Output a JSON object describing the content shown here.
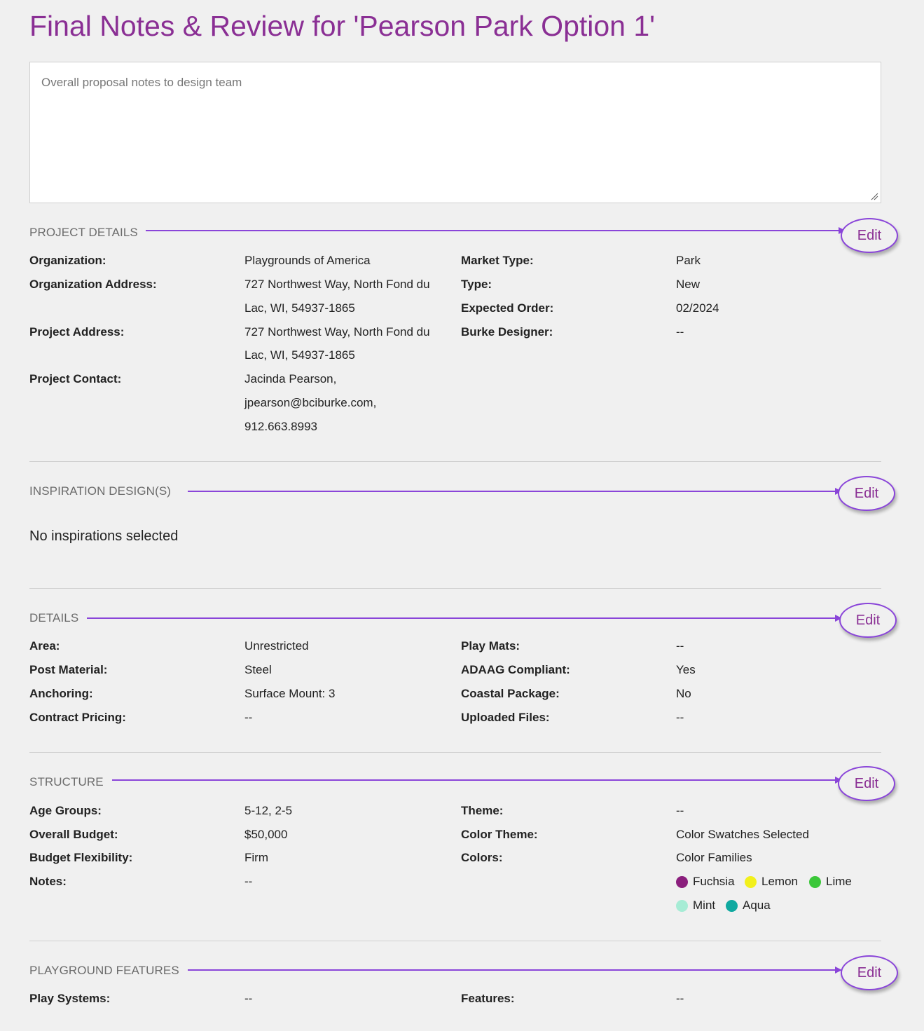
{
  "page": {
    "title": "Final Notes & Review for 'Pearson Park Option 1'",
    "notes_placeholder": "Overall proposal notes to design team",
    "notes_value": ""
  },
  "edit_label": "Edit",
  "project_details": {
    "title": "PROJECT DETAILS",
    "organization": {
      "label": "Organization:",
      "value": "Playgrounds of America"
    },
    "organization_address": {
      "label": "Organization Address:",
      "line1": "727 Northwest Way, North Fond du",
      "line2": "Lac, WI, 54937-1865"
    },
    "project_address": {
      "label": "Project Address:",
      "line1": "727 Northwest Way, North Fond du",
      "line2": "Lac, WI, 54937-1865"
    },
    "project_contact": {
      "label": "Project Contact:",
      "line1": "Jacinda Pearson,",
      "line2": "jpearson@bciburke.com,",
      "line3": "912.663.8993"
    },
    "market_type": {
      "label": "Market Type:",
      "value": "Park"
    },
    "type": {
      "label": "Type:",
      "value": "New"
    },
    "expected_order": {
      "label": "Expected Order:",
      "value": "02/2024"
    },
    "burke_designer": {
      "label": "Burke Designer:",
      "value": "--"
    }
  },
  "inspiration": {
    "title": "INSPIRATION DESIGN(S)",
    "empty_text": "No inspirations selected"
  },
  "details": {
    "title": "DETAILS",
    "area": {
      "label": "Area:",
      "value": "Unrestricted"
    },
    "post_material": {
      "label": "Post Material:",
      "value": "Steel"
    },
    "anchoring": {
      "label": "Anchoring:",
      "value": "Surface Mount: 3"
    },
    "contract_pricing": {
      "label": "Contract Pricing:",
      "value": "--"
    },
    "play_mats": {
      "label": "Play Mats:",
      "value": "--"
    },
    "adaag": {
      "label": "ADAAG Compliant:",
      "value": "Yes"
    },
    "coastal": {
      "label": "Coastal Package:",
      "value": "No"
    },
    "uploaded_files": {
      "label": "Uploaded Files:",
      "value": "--"
    }
  },
  "structure": {
    "title": "STRUCTURE",
    "age_groups": {
      "label": "Age Groups:",
      "value": "5-12, 2-5"
    },
    "overall_budget": {
      "label": "Overall Budget:",
      "value": "$50,000"
    },
    "budget_flexibility": {
      "label": "Budget Flexibility:",
      "value": "Firm"
    },
    "notes": {
      "label": "Notes:",
      "value": "--"
    },
    "theme": {
      "label": "Theme:",
      "value": "--"
    },
    "color_theme": {
      "label": "Color Theme:",
      "value": "Color Swatches Selected"
    },
    "colors": {
      "label": "Colors:",
      "value": "Color Families"
    },
    "swatches": [
      {
        "name": "Fuchsia",
        "color": "#8b1f7d"
      },
      {
        "name": "Lemon",
        "color": "#f2f01c"
      },
      {
        "name": "Lime",
        "color": "#3bc739"
      },
      {
        "name": "Mint",
        "color": "#a6ecd5"
      },
      {
        "name": "Aqua",
        "color": "#10a9a0"
      }
    ]
  },
  "features": {
    "title": "PLAYGROUND FEATURES",
    "play_systems": {
      "label": "Play Systems:",
      "value": "--"
    },
    "features": {
      "label": "Features:",
      "value": "--"
    }
  },
  "colors": {
    "accent": "#8a2f94",
    "annotation": "#8a45d9"
  }
}
